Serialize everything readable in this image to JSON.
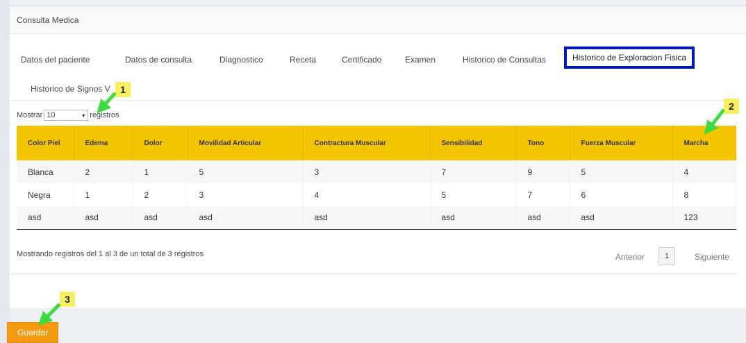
{
  "panel": {
    "title": "Consulta Medica"
  },
  "tabs": [
    {
      "label": "Datos del paciente"
    },
    {
      "label": "Datos de consulta"
    },
    {
      "label": "Diagnostico"
    },
    {
      "label": "Receta"
    },
    {
      "label": "Certificado"
    },
    {
      "label": "Examen"
    },
    {
      "label": "Historico de Consultas"
    },
    {
      "label": "Historico de Exploracion Fisica"
    },
    {
      "label": "Historico de Signos V"
    }
  ],
  "active_tab": "Historico de Exploracion Fisica",
  "length_control": {
    "prefix": "Mostrar",
    "value": "10",
    "suffix": "registros",
    "arrow": "▾"
  },
  "table": {
    "headers": [
      "Color Piel",
      "Edema",
      "Dolor",
      "Movilidad Articular",
      "Contractura Muscular",
      "Sensibilidad",
      "Tono",
      "Fuerza Muscular",
      "Marcha"
    ],
    "rows": [
      [
        "Blanca",
        "2",
        "1",
        "5",
        "3",
        "7",
        "9",
        "5",
        "4"
      ],
      [
        "Negra",
        "1",
        "2",
        "3",
        "4",
        "5",
        "7",
        "6",
        "8"
      ],
      [
        "asd",
        "asd",
        "asd",
        "asd",
        "asd",
        "asd",
        "asd",
        "asd",
        "123"
      ]
    ]
  },
  "info": "Mostrando registros del 1 al 3 de un total de 3 registros",
  "pagination": {
    "prev": "Anterior",
    "page": "1",
    "next": "Siguiente"
  },
  "save_button": "Guardar",
  "annotations": [
    {
      "label": "1"
    },
    {
      "label": "2"
    },
    {
      "label": "3"
    }
  ],
  "colors": {
    "header_bg": "#f2c500",
    "active_tab_border": "#0014c8",
    "save_button": "#f39c12",
    "annotation_badge": "#f7f061",
    "annotation_arrow": "#3ddc3d"
  }
}
